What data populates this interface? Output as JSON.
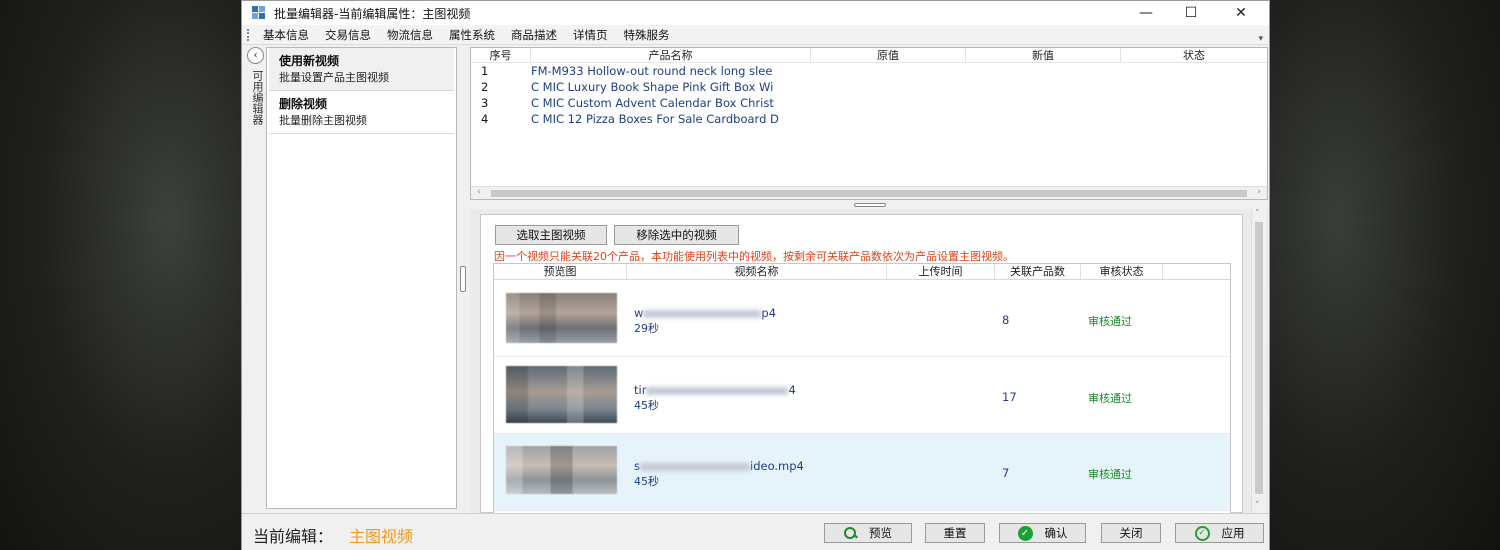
{
  "window": {
    "title": "批量编辑器-当前编辑属性：主图视频",
    "minimize": "—",
    "maximize": "☐",
    "close": "✕"
  },
  "menu": [
    "基本信息",
    "交易信息",
    "物流信息",
    "属性系统",
    "商品描述",
    "详情页",
    "特殊服务"
  ],
  "side_tab": {
    "collapse": "‹",
    "label": "可用编辑器"
  },
  "operations": [
    {
      "title": "使用新视频",
      "desc": "批量设置产品主图视频"
    },
    {
      "title": "删除视频",
      "desc": "批量删除主图视频"
    }
  ],
  "product_grid": {
    "columns": [
      "序号",
      "产品名称",
      "原值",
      "新值",
      "状态"
    ],
    "rows": [
      {
        "idx": "1",
        "name": "FM-M933 Hollow-out round neck long slee"
      },
      {
        "idx": "2",
        "name": "C MIC Luxury Book Shape Pink Gift Box Wi"
      },
      {
        "idx": "3",
        "name": "C MIC Custom Advent Calendar Box Christ"
      },
      {
        "idx": "4",
        "name": "C MIC 12 Pizza Boxes For Sale Cardboard D"
      }
    ]
  },
  "video_panel": {
    "pick_button": "选取主图视频",
    "remove_button": "移除选中的视频",
    "notice": "因一个视频只能关联20个产品，本功能使用列表中的视频，按剩余可关联产品数依次为产品设置主图视频。",
    "columns": [
      "预览图",
      "视频名称",
      "上传时间",
      "关联产品数",
      "审核状态"
    ],
    "rows": [
      {
        "name_start": "w",
        "name_end": "p4",
        "duration": "29秒",
        "count": "8",
        "status": "审核通过"
      },
      {
        "name_start": "tir",
        "name_end": "4",
        "duration": "45秒",
        "count": "17",
        "status": "审核通过"
      },
      {
        "name_start": "s",
        "name_end": "ideo.mp4",
        "duration": "45秒",
        "count": "7",
        "status": "审核通过"
      }
    ]
  },
  "footer": {
    "current_label": "当前编辑：",
    "current_value": "主图视频",
    "preview": "预览",
    "reset": "重置",
    "confirm": "确认",
    "close": "关闭",
    "apply": "应用"
  },
  "colors": {
    "notice_red": "#e2421a",
    "status_green": "#1a8a2a",
    "current_value_orange": "#f29a1a",
    "link_blue": "#1f3d8a"
  }
}
